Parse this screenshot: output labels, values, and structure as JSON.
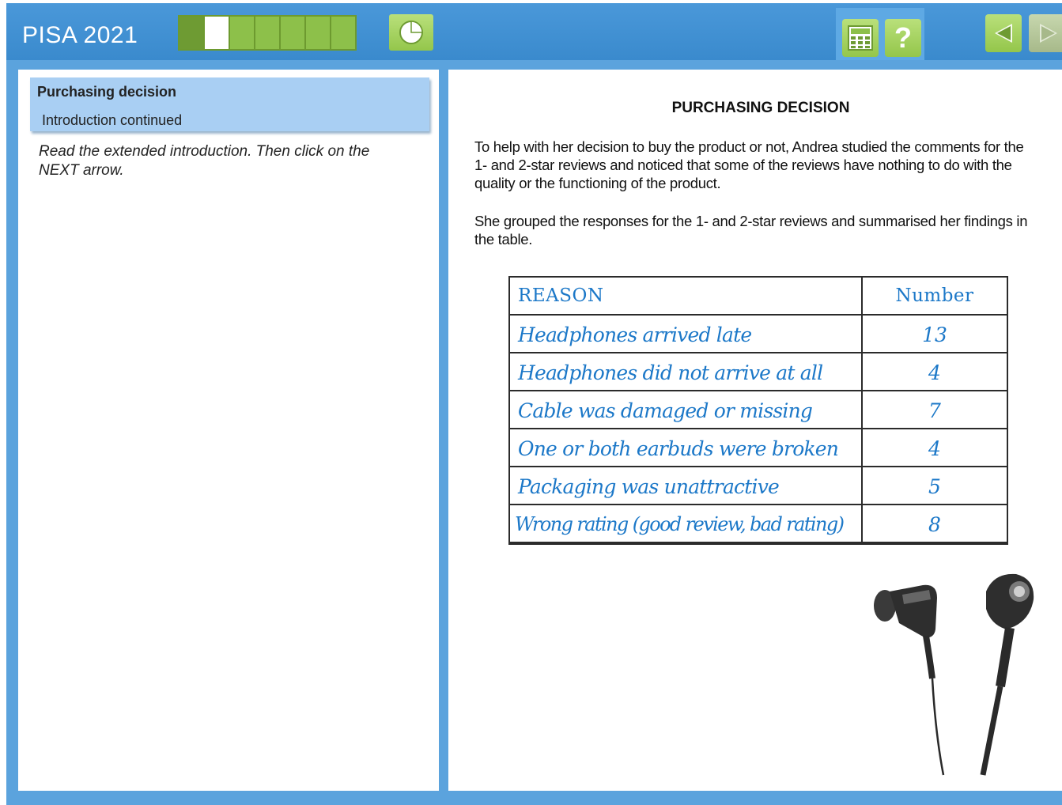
{
  "header": {
    "app_title": "PISA 2021",
    "progress": {
      "total_segments": 7,
      "current_segment": 2
    }
  },
  "toolbar": {
    "timer_icon": "timer-icon",
    "calculator_icon": "calculator-icon",
    "help_label": "?",
    "back_icon": "back-arrow-icon",
    "next_icon": "next-arrow-icon"
  },
  "left_panel": {
    "unit_title": "Purchasing decision",
    "unit_subtitle": "Introduction continued",
    "instruction": "Read the extended introduction. Then click on the NEXT arrow."
  },
  "document": {
    "title": "PURCHASING DECISION",
    "paragraph_1": "To help with her decision to buy the product or not, Andrea studied the comments for the 1- and 2-star reviews and noticed that some of the reviews have nothing to do with the quality or the functioning of the product.",
    "paragraph_2": "She grouped the responses for the 1- and 2-star reviews and summarised her findings in the table.",
    "table": {
      "headers": {
        "reason": "REASON",
        "number": "Number"
      },
      "rows": [
        {
          "reason": "Headphones arrived late",
          "number": "13"
        },
        {
          "reason": "Headphones did not arrive at all",
          "number": "4"
        },
        {
          "reason": "Cable was damaged or missing",
          "number": "7"
        },
        {
          "reason": "One or both earbuds were broken",
          "number": "4"
        },
        {
          "reason": "Packaging was unattractive",
          "number": "5"
        },
        {
          "reason": "Wrong rating (good review, bad rating)",
          "number": "8"
        }
      ]
    },
    "illustration": "earbuds-illustration"
  },
  "colors": {
    "frame_blue": "#5ba3dd",
    "header_blue": "#3a8acd",
    "button_green": "#94c64b",
    "panel_header": "#a9cff3",
    "handwriting_blue": "#1c78c8"
  }
}
